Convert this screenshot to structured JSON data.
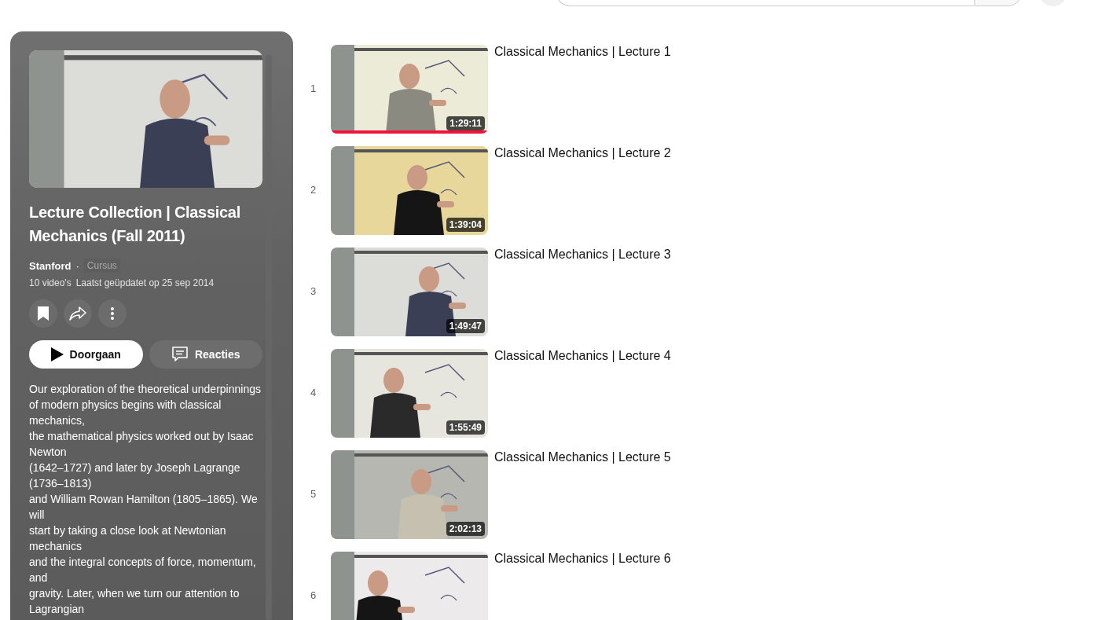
{
  "playlist": {
    "title": "Lecture Collection | Classical Mechanics (Fall 2011)",
    "channel": "Stanford",
    "separator": "·",
    "tag": "Cursus",
    "video_count": "10 video's",
    "updated": "Laatst geüpdatet op 25 sep 2014",
    "play_button": "Doorgaan",
    "comments_button": "Reacties",
    "description": "Our exploration of the theoretical underpinnings of modern physics begins with classical mechanics,\nthe mathematical physics worked out by Isaac Newton\n(1642–1727) and later by Joseph Lagrange (1736–1813)\nand William Rowan Hamilton (1805–1865). We will\nstart by taking a close look at Newtonian mechanics\nand the integral concepts of force, momentum, and\ngravity. Later, when we turn our attention to Lagrangian"
  },
  "videos": [
    {
      "index": "1",
      "title": "Classical Mechanics | Lecture 1",
      "duration": "1:29:11",
      "level": 1
    },
    {
      "index": "2",
      "title": "Classical Mechanics | Lecture 2",
      "duration": "1:39:04"
    },
    {
      "index": "3",
      "title": "Classical Mechanics | Lecture 3",
      "duration": "1:49:47"
    },
    {
      "index": "4",
      "title": "Classical Mechanics | Lecture 4",
      "duration": "1:55:49"
    },
    {
      "index": "5",
      "title": "Classical Mechanics | Lecture 5",
      "duration": "2:02:13"
    },
    {
      "index": "6",
      "title": "Classical Mechanics | Lecture 6"
    }
  ]
}
